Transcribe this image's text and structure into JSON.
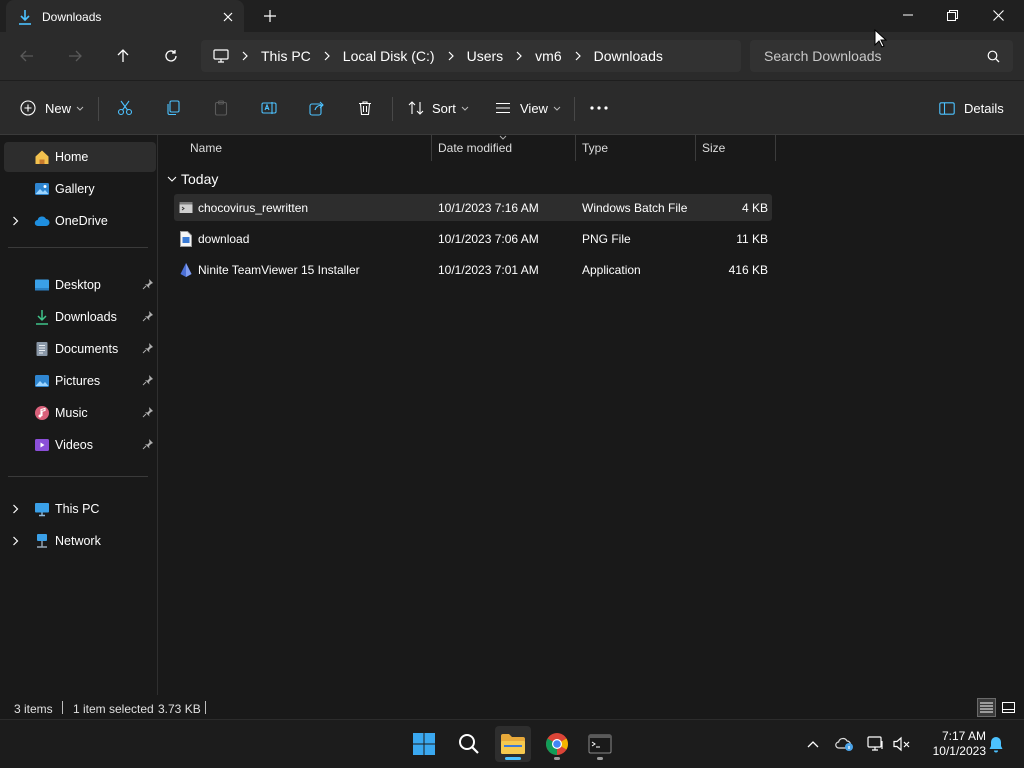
{
  "window": {
    "tab_title": "Downloads"
  },
  "breadcrumb": [
    "This PC",
    "Local Disk (C:)",
    "Users",
    "vm6",
    "Downloads"
  ],
  "search": {
    "placeholder": "Search Downloads"
  },
  "commandbar": {
    "new_label": "New",
    "sort_label": "Sort",
    "view_label": "View",
    "details_label": "Details"
  },
  "sidebar": {
    "home": "Home",
    "gallery": "Gallery",
    "onedrive": "OneDrive",
    "desktop": "Desktop",
    "downloads": "Downloads",
    "documents": "Documents",
    "pictures": "Pictures",
    "music": "Music",
    "videos": "Videos",
    "thispc": "This PC",
    "network": "Network"
  },
  "columns": {
    "name": "Name",
    "date": "Date modified",
    "type": "Type",
    "size": "Size"
  },
  "group_label": "Today",
  "files": [
    {
      "name": "chocovirus_rewritten",
      "date": "10/1/2023 7:16 AM",
      "type": "Windows Batch File",
      "size": "4 KB",
      "icon": "batch-file-icon"
    },
    {
      "name": "download",
      "date": "10/1/2023 7:06 AM",
      "type": "PNG File",
      "size": "11 KB",
      "icon": "png-file-icon"
    },
    {
      "name": "Ninite TeamViewer 15 Installer",
      "date": "10/1/2023 7:01 AM",
      "type": "Application",
      "size": "416 KB",
      "icon": "application-icon"
    }
  ],
  "status": {
    "items": "3 items",
    "selected": "1 item selected",
    "selected_size": "3.73 KB"
  },
  "clock": {
    "time": "7:17 AM",
    "date": "10/1/2023"
  },
  "colors": {
    "accent": "#4cc2ff",
    "background": "#191919",
    "chrome": "#2b2b2b"
  }
}
